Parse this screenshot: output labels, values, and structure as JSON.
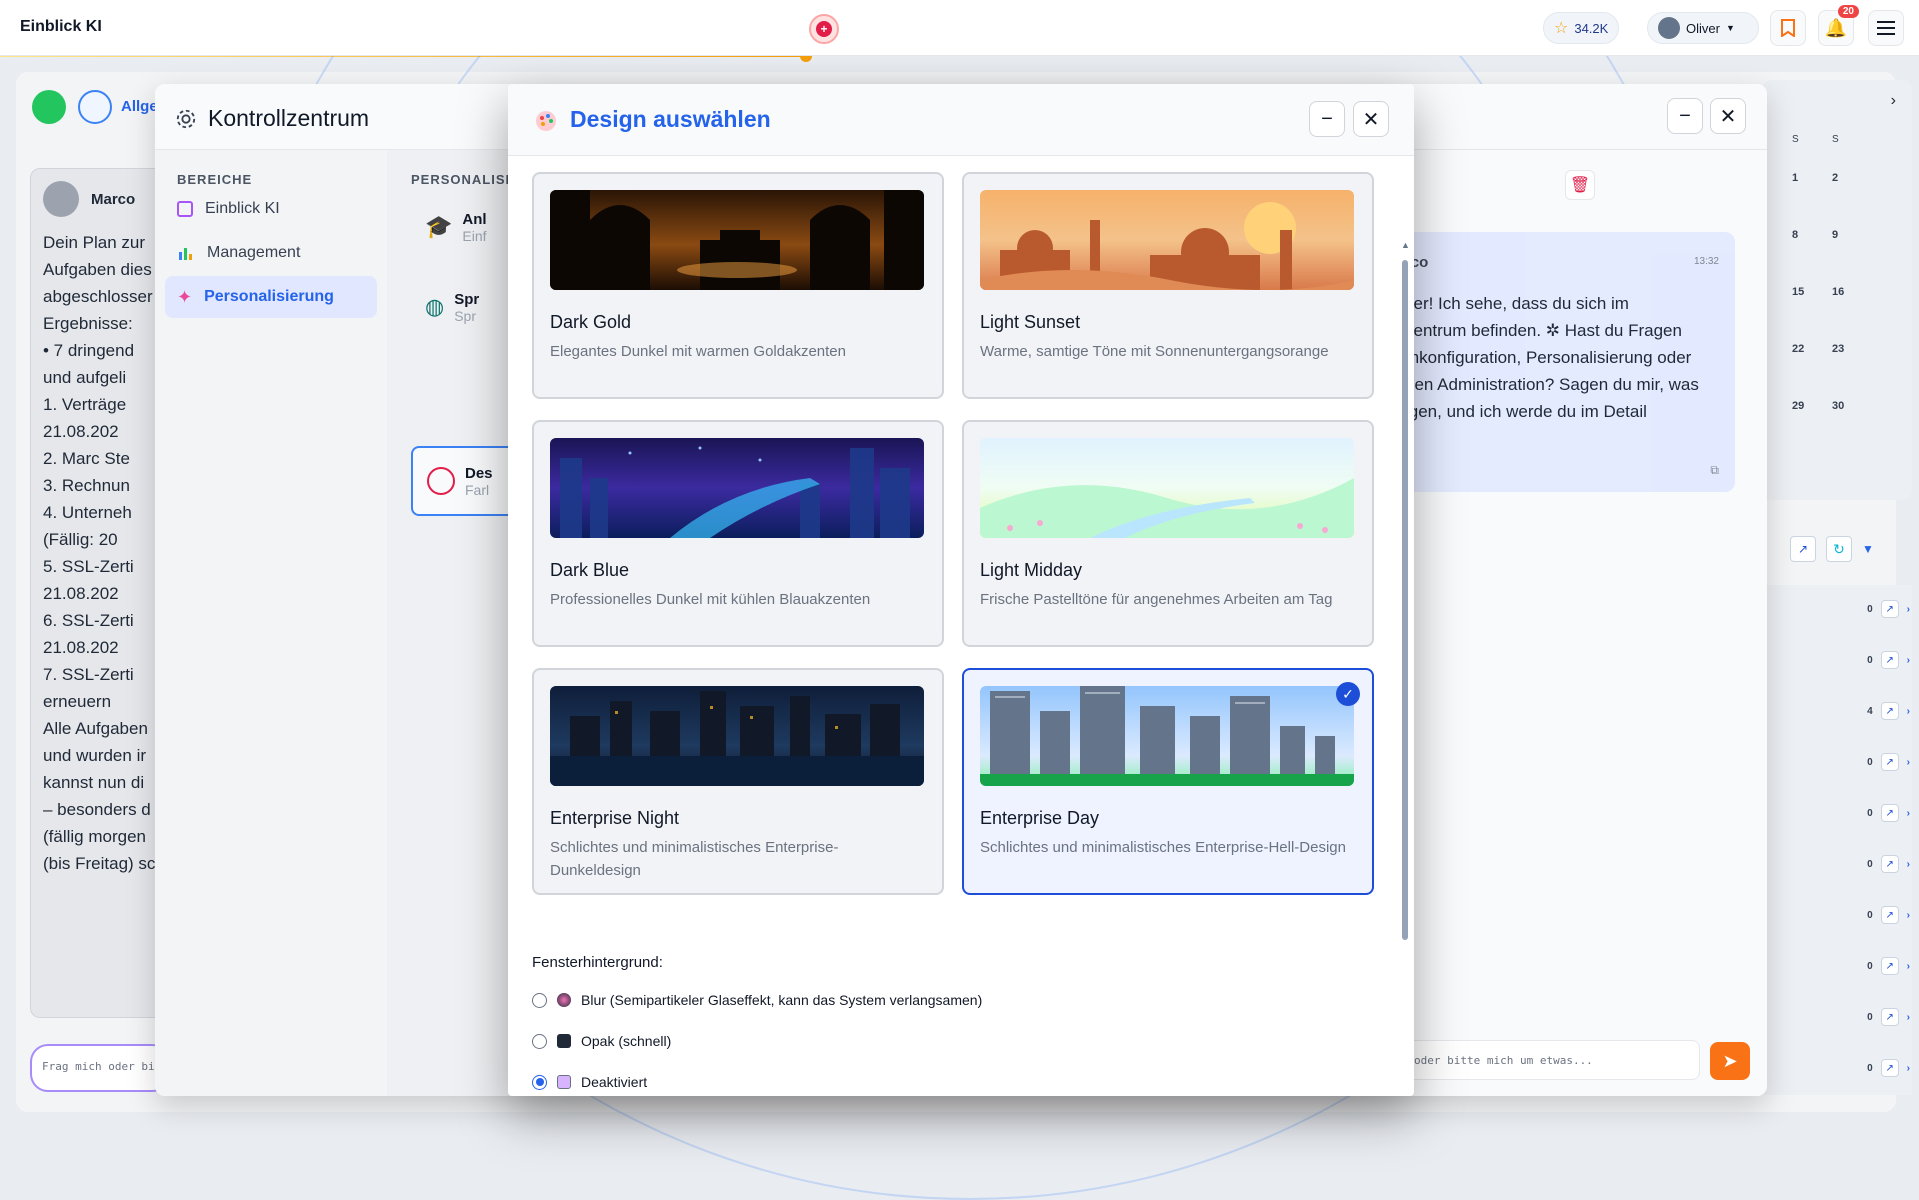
{
  "app": {
    "brand": "Einblick KI"
  },
  "topbar": {
    "stars": "34.2K",
    "user": "Oliver",
    "notifications": "20"
  },
  "background_chat": {
    "sender": "Marco",
    "lines": [
      "Dein Plan zur",
      "Aufgaben dies",
      "abgeschlosser",
      "Ergebnisse:",
      "• 7 dringend",
      "und aufgeli",
      "1. Verträge",
      "21.08.202",
      "2. Marc Ste",
      "3. Rechnun",
      "4. Unterneh",
      "(Fällig: 20",
      "5. SSL-Zerti",
      "21.08.202",
      "6. SSL-Zerti",
      "21.08.202",
      "7. SSL-Zerti",
      "erneuern",
      "Alle Aufgaben",
      "und wurden ir",
      "kannst nun di",
      "– besonders d",
      "(fällig morgen",
      "(bis Freitag) sc"
    ],
    "input_placeholder": "Frag mich oder bi",
    "top_label": "Allge"
  },
  "right_chat": {
    "sender_partial": "rco",
    "time": "13:32",
    "lines": [
      "ver! Ich sehe, dass du sich im",
      "zentrum befinden. ✲ Hast du Fragen",
      "mkonfiguration, Personalisierung oder",
      "nen Administration? Sagen du mir, was",
      "igen, und ich werde du im Detail"
    ],
    "input_placeholder": "oder bitte mich um etwas...",
    "header_partial": "o"
  },
  "calendar": {
    "weekday_labels": [
      "S",
      "S"
    ],
    "rows": [
      [
        "1",
        "2"
      ],
      [
        "8",
        "9"
      ],
      [
        "15",
        "16"
      ],
      [
        "22",
        "23"
      ],
      [
        "29",
        "30"
      ]
    ]
  },
  "task_list": {
    "counts": [
      "0",
      "0",
      "4",
      "0",
      "0",
      "0",
      "0",
      "0",
      "0",
      "0"
    ]
  },
  "kontrollzentrum": {
    "title": "Kontrollzentrum",
    "sidebar_heading": "BEREICHE",
    "sidebar_items": [
      {
        "label": "Einblick KI",
        "icon": "chip-icon"
      },
      {
        "label": "Management",
        "icon": "bar-chart-icon"
      },
      {
        "label": "Personalisierung",
        "icon": "sparkle-icon"
      }
    ],
    "main_heading": "PERSONALISI",
    "options": [
      {
        "title": "Anl",
        "sub": "Einf",
        "icon": "graduation-cap-icon"
      },
      {
        "title": "Spr",
        "sub": "Spr",
        "icon": "globe-icon"
      },
      {
        "title": "Des",
        "sub": "Farl",
        "icon": "palette-icon"
      }
    ]
  },
  "design_modal": {
    "title": "Design auswählen",
    "themes": [
      {
        "name": "Dark Gold",
        "description": "Elegantes Dunkel mit warmen Goldakzenten",
        "selected": false
      },
      {
        "name": "Light Sunset",
        "description": "Warme, samtige Töne mit Sonnenuntergangsorange",
        "selected": false
      },
      {
        "name": "Dark Blue",
        "description": "Professionelles Dunkel mit kühlen Blauakzenten",
        "selected": false
      },
      {
        "name": "Light Midday",
        "description": "Frische Pastelltöne für angenehmes Arbeiten am Tag",
        "selected": false
      },
      {
        "name": "Enterprise Night",
        "description": "Schlichtes und minimalistisches Enterprise-Dunkeldesign",
        "selected": false
      },
      {
        "name": "Enterprise Day",
        "description": "Schlichtes und minimalistisches Enterprise-Hell-Design",
        "selected": true
      }
    ],
    "background_label": "Fensterhintergrund:",
    "background_options": [
      {
        "label": "Blur (Semipartikeler Glaseffekt, kann das System verlangsamen)",
        "checked": false
      },
      {
        "label": "Opak (schnell)",
        "checked": false
      },
      {
        "label": "Deaktiviert",
        "checked": true
      }
    ]
  },
  "colors": {
    "accent": "#2563eb",
    "orange": "#f97316",
    "alert": "#ef4444"
  }
}
